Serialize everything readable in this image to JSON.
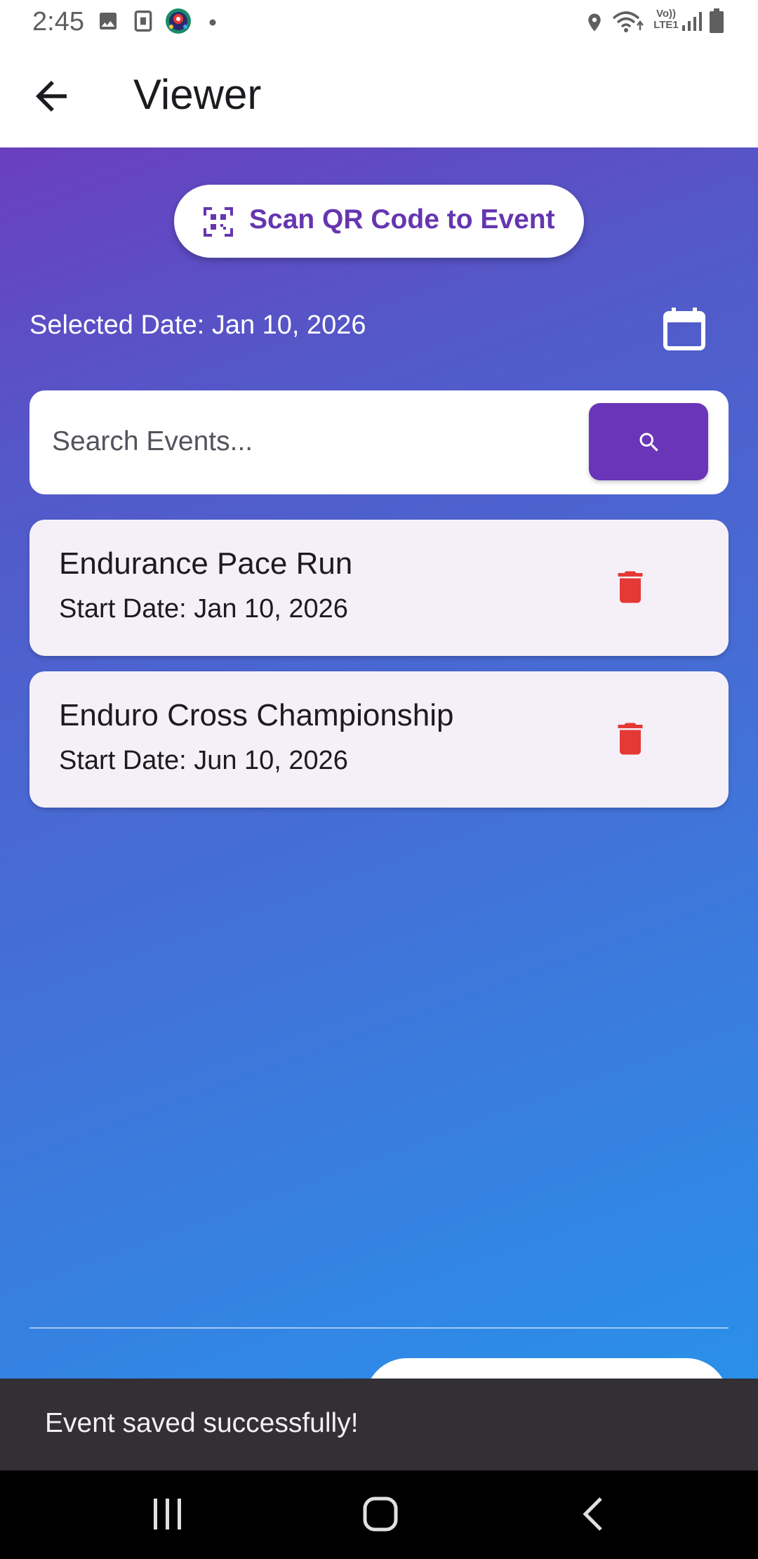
{
  "status_bar": {
    "time": "2:45",
    "icons": [
      "image-icon",
      "sim-card-icon",
      "app-badge-icon",
      "dot-icon",
      "location-icon",
      "wifi-icon",
      "volte-icon",
      "signal-icon",
      "battery-icon"
    ],
    "volte_text_1": "Vo))",
    "volte_text_2": "LTE1"
  },
  "app_bar": {
    "title": "Viewer",
    "back_icon": "arrow-back-icon"
  },
  "scan_button": {
    "label": "Scan QR Code to Event",
    "icon": "qr-code-scanner-icon"
  },
  "date_selector": {
    "text": "Selected Date: Jan 10, 2026",
    "icon": "calendar-icon"
  },
  "search": {
    "placeholder": "Search Events...",
    "value": "",
    "button_icon": "search-icon"
  },
  "events": [
    {
      "title": "Endurance Pace Run",
      "start_date": "Start Date: Jan 10, 2026",
      "action_icon": "delete-icon"
    },
    {
      "title": "Enduro Cross Championship",
      "start_date": "Start Date: Jun 10, 2026",
      "action_icon": "delete-icon"
    }
  ],
  "snackbar": {
    "message": "Event saved successfully!"
  },
  "nav_bar": {
    "buttons": [
      "recents-icon",
      "home-icon",
      "back-icon"
    ]
  },
  "colors": {
    "primary": "#6a35b8",
    "gradient_top": "#6a3fc0",
    "gradient_bottom": "#2a90ea",
    "delete": "#e53935",
    "card_bg": "#f5f0f7",
    "snackbar_bg": "#322f35"
  }
}
